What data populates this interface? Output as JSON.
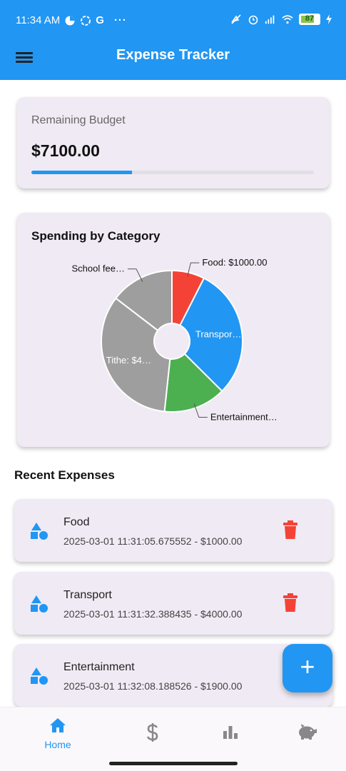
{
  "status": {
    "time": "11:34 AM",
    "left_icons": [
      "data-saver-icon",
      "circle-icon",
      "google-icon",
      "more-dots-icon"
    ],
    "carrier_letter": "G",
    "dots": "···",
    "battery": "87"
  },
  "appbar": {
    "title": "Expense Tracker"
  },
  "budget": {
    "label": "Remaining Budget",
    "value": "$7100.00",
    "progress_fraction": 0.355
  },
  "chart": {
    "title": "Spending by Category"
  },
  "chart_data": {
    "type": "pie",
    "title": "Spending by Category",
    "slices": [
      {
        "label": "Food: $1000.00",
        "value": 1000,
        "color": "#f44336",
        "label_position": "outside"
      },
      {
        "label": "Transpor…",
        "value": 4000,
        "color": "#2196f3",
        "label_position": "inside"
      },
      {
        "label": "Entertainment…",
        "value": 1900,
        "color": "#4caf50",
        "label_position": "outside"
      },
      {
        "label": "Tithe: $4…",
        "value": 4500,
        "color": "#9e9e9e",
        "label_position": "inside"
      },
      {
        "label": "School fee…",
        "value": 1950,
        "color": "#9e9e9e",
        "label_position": "outside"
      }
    ]
  },
  "recent": {
    "title": "Recent Expenses",
    "items": [
      {
        "name": "Food",
        "meta": "2025-03-01 11:31:05.675552 - $1000.00"
      },
      {
        "name": "Transport",
        "meta": "2025-03-01 11:31:32.388435 - $4000.00"
      },
      {
        "name": "Entertainment",
        "meta": "2025-03-01 11:32:08.188526 - $1900.00"
      }
    ]
  },
  "fab": {
    "label": "+"
  },
  "nav": {
    "items": [
      {
        "icon": "home-icon",
        "label": "Home",
        "active": true
      },
      {
        "icon": "dollar-icon",
        "label": "",
        "active": false
      },
      {
        "icon": "bar-chart-icon",
        "label": "",
        "active": false
      },
      {
        "icon": "piggy-bank-icon",
        "label": "",
        "active": false
      }
    ]
  },
  "colors": {
    "primary": "#2196f3",
    "card_bg": "#f0eaf4",
    "danger": "#f44336",
    "icon_inactive": "#888888"
  }
}
